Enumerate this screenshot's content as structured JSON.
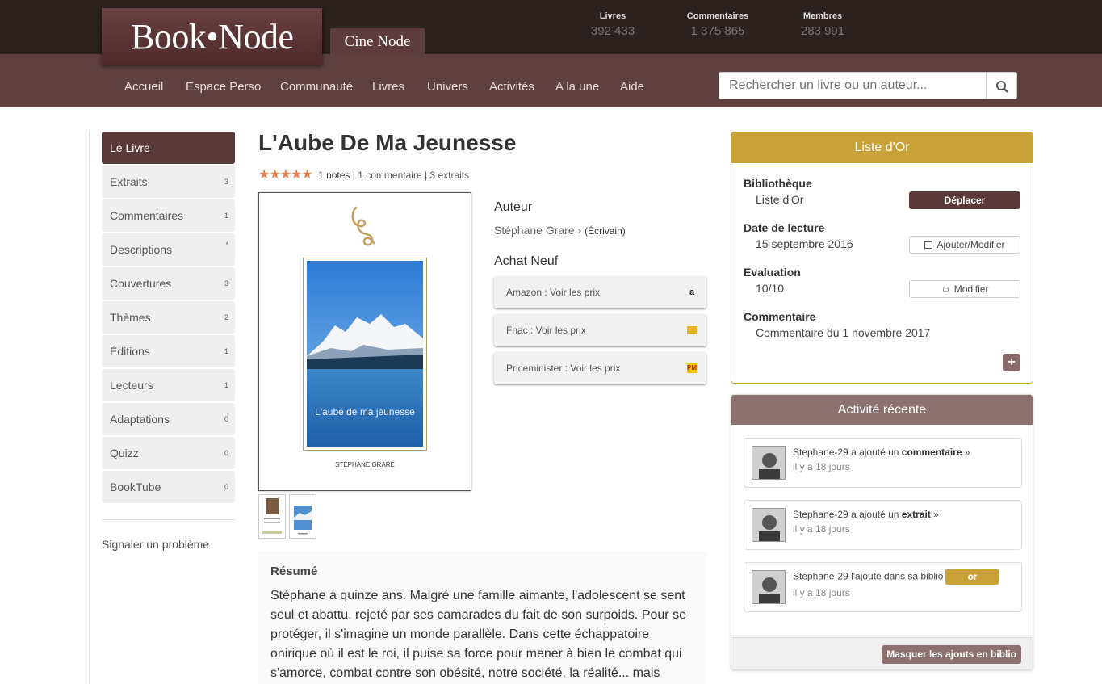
{
  "header": {
    "logo": "Book•Node",
    "cine_node": "Cine Node",
    "stats": [
      {
        "label": "Livres",
        "value": "392 433"
      },
      {
        "label": "Commentaires",
        "value": "1 375 865"
      },
      {
        "label": "Membres",
        "value": "283 991"
      }
    ]
  },
  "nav": {
    "items": [
      "Accueil",
      "Espace Perso",
      "Communauté",
      "Livres",
      "Univers",
      "Activités",
      "A la une",
      "Aide"
    ],
    "search_placeholder": "Rechercher un livre ou un auteur..."
  },
  "sidebar": {
    "items": [
      {
        "label": "Le Livre",
        "count": ""
      },
      {
        "label": "Extraits",
        "count": "3"
      },
      {
        "label": "Commentaires",
        "count": "1"
      },
      {
        "label": "Descriptions",
        "count": "*"
      },
      {
        "label": "Couvertures",
        "count": "3"
      },
      {
        "label": "Thèmes",
        "count": "2"
      },
      {
        "label": "Éditions",
        "count": "1"
      },
      {
        "label": "Lecteurs",
        "count": "1"
      },
      {
        "label": "Adaptations",
        "count": "0"
      },
      {
        "label": "Quizz",
        "count": "0"
      },
      {
        "label": "BookTube",
        "count": "0"
      }
    ],
    "report": "Signaler un problème"
  },
  "book": {
    "title": "L'Aube De Ma Jeunesse",
    "stars": "★★★★★",
    "notes": "1 notes",
    "sep": "|",
    "comments": "1 commentaire",
    "extracts": "3 extraits",
    "cover_logo": "lea",
    "cover_caption": "L'aube de ma jeunesse",
    "cover_author": "STÉPHANE GRARE",
    "author_heading": "Auteur",
    "author_name": "Stéphane Grare",
    "author_chevron": "›",
    "author_role": "(Écrivain)",
    "buy_heading": "Achat Neuf",
    "buy": [
      {
        "label": "Amazon : Voir les prix",
        "icon": "a",
        "icon_name": "amazon-icon"
      },
      {
        "label": "Fnac : Voir les prix",
        "icon": "",
        "icon_name": "fnac-icon"
      },
      {
        "label": "Priceminister : Voir les prix",
        "icon": "PM",
        "icon_name": "priceminister-icon"
      }
    ],
    "resume_heading": "Résumé",
    "resume_text": "Stéphane a quinze ans. Malgré une famille aimante, l'adolescent se sent seul et abattu, rejeté par ses camarades du fait de son surpoids. Pour se protéger, il s'imagine un monde parallèle. Dans cette échappatoire onirique où il est le roi, il puise sa force pour mener à bien le combat qui s'amorce, combat contre son obésité, notre société, la réalité... mais"
  },
  "liste_or": {
    "title": "Liste d'Or",
    "bibliotheque_label": "Bibliothèque",
    "bibliotheque_value": "Liste d'Or",
    "deplacer": "Déplacer",
    "date_label": "Date de lecture",
    "date_value": "15 septembre 2016",
    "ajouter": "Ajouter/Modifier",
    "eval_label": "Evaluation",
    "eval_value": "10/10",
    "modifier": "Modifier",
    "comment_label": "Commentaire",
    "comment_value": "Commentaire du 1 novembre 2017",
    "plus": "+"
  },
  "activity": {
    "title": "Activité récente",
    "items": [
      {
        "user": "Stephane-29",
        "action": " a ajouté un ",
        "object": "commentaire",
        "suffix": " »",
        "time": "il y a 18 jours"
      },
      {
        "user": "Stephane-29",
        "action": " a ajouté un ",
        "object": "extrait",
        "suffix": " »",
        "time": "il y a 18 jours"
      },
      {
        "user": "Stephane-29",
        "action": " l'ajoute dans sa biblio",
        "object": "",
        "suffix": "",
        "badge": "or",
        "time": "il y a 18 jours"
      }
    ],
    "hide_button": "Masquer les ajouts en biblio"
  },
  "colors": {
    "brand_dark": "#2b211e",
    "brand": "#5f4040",
    "gold": "#c9a237",
    "activity_header": "#8d7070",
    "star": "#e7804a"
  }
}
